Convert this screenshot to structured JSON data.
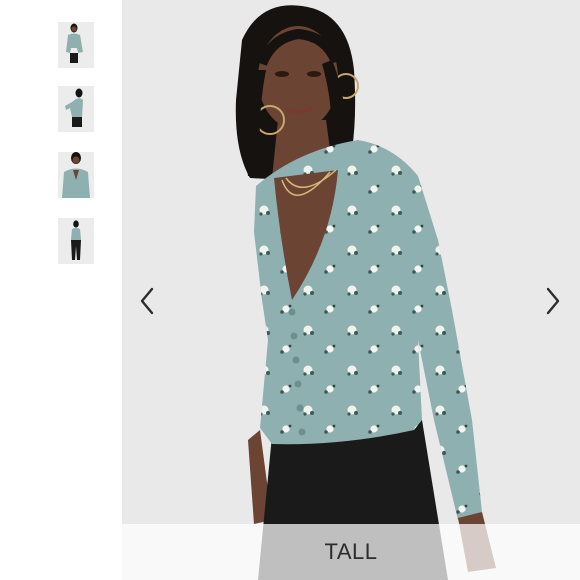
{
  "gallery": {
    "badge_label": "TALL",
    "prev_icon": "chevron-left-icon",
    "next_icon": "chevron-right-icon",
    "thumbnail_count": 4,
    "colors": {
      "blouse": "#8fb0b0",
      "jeans": "#1a1a1a",
      "skin": "#6b4434",
      "hair": "#161210",
      "background": "#e9e9e9"
    }
  }
}
